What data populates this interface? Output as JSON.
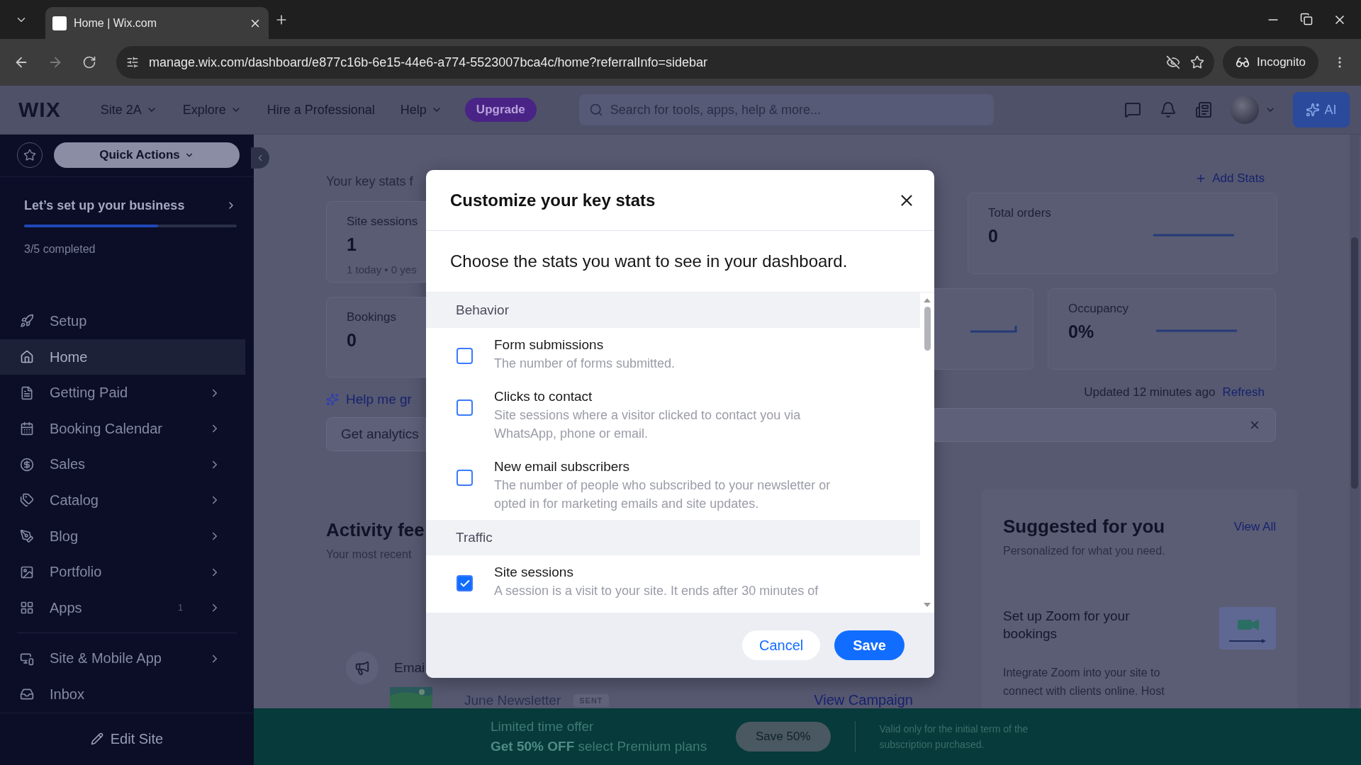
{
  "browser": {
    "tab_title": "Home | Wix.com",
    "url": "manage.wix.com/dashboard/e877c16b-6e15-44e6-a774-5523007bca4c/home?referralInfo=sidebar",
    "profile_label": "Incognito"
  },
  "topbar": {
    "logo": "WIX",
    "nav": [
      {
        "label": "Site 2A",
        "dropdown": true
      },
      {
        "label": "Explore",
        "dropdown": true
      },
      {
        "label": "Hire a Professional",
        "dropdown": false
      },
      {
        "label": "Help",
        "dropdown": true
      }
    ],
    "upgrade": "Upgrade",
    "search_placeholder": "Search for tools, apps, help & more...",
    "ai_label": "AI"
  },
  "sidebar": {
    "quick_actions": "Quick Actions",
    "setup": {
      "title": "Let’s set up your business",
      "level": 0.63,
      "progress_text": "3/5 completed"
    },
    "items": [
      {
        "label": "Setup",
        "selected": false,
        "chevron": false
      },
      {
        "label": "Home",
        "selected": true,
        "chevron": false
      },
      {
        "label": "Getting Paid",
        "selected": false,
        "chevron": true
      },
      {
        "label": "Booking Calendar",
        "selected": false,
        "chevron": true
      },
      {
        "label": "Sales",
        "selected": false,
        "chevron": true
      },
      {
        "label": "Catalog",
        "selected": false,
        "chevron": true
      },
      {
        "label": "Blog",
        "selected": false,
        "chevron": true
      },
      {
        "label": "Portfolio",
        "selected": false,
        "chevron": true
      },
      {
        "label": "Apps",
        "selected": false,
        "chevron": true,
        "badge": "1"
      }
    ],
    "secondary_items": [
      {
        "label": "Site & Mobile App",
        "selected": false,
        "chevron": true
      },
      {
        "label": "Inbox",
        "selected": false,
        "chevron": false
      }
    ],
    "edit_site": "Edit Site"
  },
  "dashboard": {
    "key_stats_title": "Your key stats f",
    "add_stats": "Add Stats",
    "left_stats": [
      {
        "title": "Site sessions",
        "value": "1",
        "detail": "1 today • 0 yes"
      },
      {
        "title": "Bookings",
        "value": "0"
      }
    ],
    "right_stats": [
      {
        "title": "Total orders",
        "value": "0"
      },
      {
        "title": "Occupancy",
        "value": "0%"
      }
    ],
    "help_link": "Help me gr",
    "analytics_field": "Get analytics",
    "updated": "Updated 12 minutes ago",
    "refresh": "Refresh",
    "activity": {
      "title": "Activity fee",
      "subtitle": "Your most recent",
      "entry_title": "Emai",
      "campaign": "June Newsletter",
      "campaign_status": "SENT",
      "campaign_link": "View Campaign"
    },
    "suggested": {
      "title": "Suggested for you",
      "view_all": "View All",
      "subtitle": "Personalized for what you need.",
      "card_title": "Set up Zoom for your bookings",
      "card_text": "Integrate Zoom into your site to connect with clients online. Host"
    }
  },
  "promo": {
    "headline": "Limited time offer",
    "offer": "**Get 50% OFF** select Premium plans",
    "button": "Save 50%",
    "note": "Valid only for the initial term of the subscription purchased."
  },
  "modal": {
    "title": "Customize your key stats",
    "subtitle": "Choose the stats you want to see in your dashboard.",
    "groups": [
      {
        "name": "Behavior",
        "items": [
          {
            "title": "Form submissions",
            "description": "The number of forms submitted.",
            "checked": false
          },
          {
            "title": "Clicks to contact",
            "description": "Site sessions where a visitor clicked to contact you via WhatsApp, phone or email.",
            "checked": false
          },
          {
            "title": "New email subscribers",
            "description": "The number of people who subscribed to your newsletter or opted in for marketing emails and site updates.",
            "checked": false
          }
        ]
      },
      {
        "name": "Traffic",
        "items": [
          {
            "title": "Site sessions",
            "description": "A session is a visit to your site. It ends after 30 minutes of",
            "checked": true
          }
        ]
      }
    ],
    "cancel": "Cancel",
    "save": "Save"
  }
}
